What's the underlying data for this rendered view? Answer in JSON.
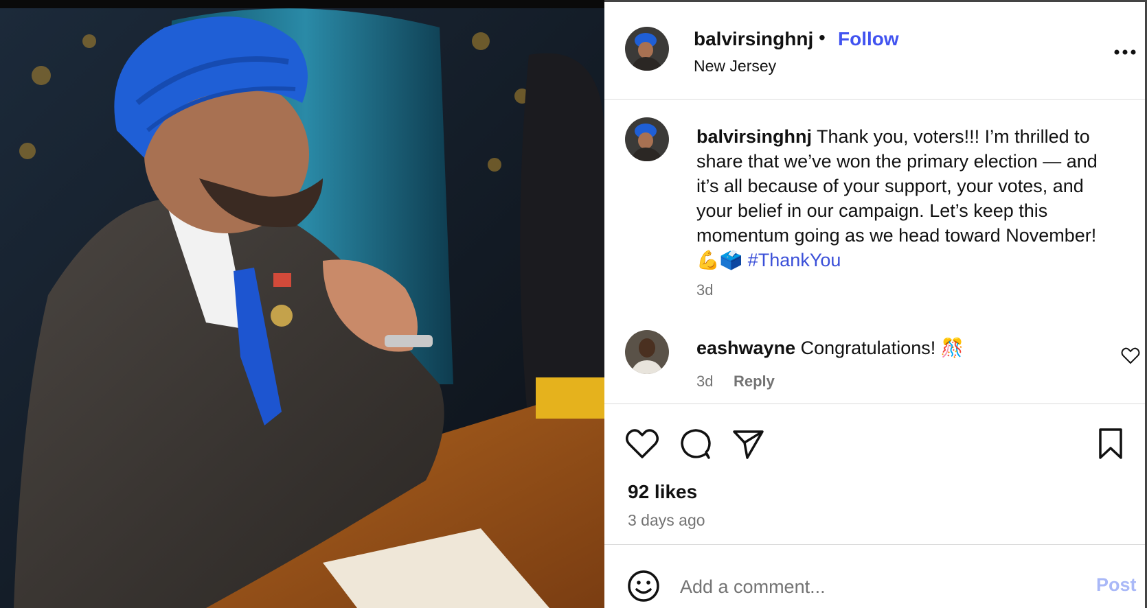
{
  "header": {
    "username": "balvirsinghnj",
    "separator": "•",
    "follow_label": "Follow",
    "location": "New Jersey"
  },
  "caption": {
    "username": "balvirsinghnj",
    "text": "Thank you, voters!!! I’m thrilled to share that we’ve won the primary election — and it’s all because of your support, your votes, and your belief in our campaign. Let’s keep this momentum going as we head toward November! 💪🗳️",
    "hashtag": "#ThankYou",
    "time": "3d"
  },
  "comment": {
    "username": "eashwayne",
    "text": "Congratulations! 🎊",
    "time": "3d",
    "reply_label": "Reply"
  },
  "actions": {
    "icons": [
      "heart-icon",
      "comment-icon",
      "share-icon",
      "bookmark-icon"
    ]
  },
  "likes_label": "92 likes",
  "posted_ago": "3 days ago",
  "composer": {
    "placeholder": "Add a comment...",
    "post_label": "Post"
  },
  "colors": {
    "link_blue": "#4153f0",
    "hashtag_blue": "#3a4fd8",
    "muted_text": "#737373",
    "post_disabled": "#a9b8f7",
    "turban_blue": "#1f5fd6"
  }
}
